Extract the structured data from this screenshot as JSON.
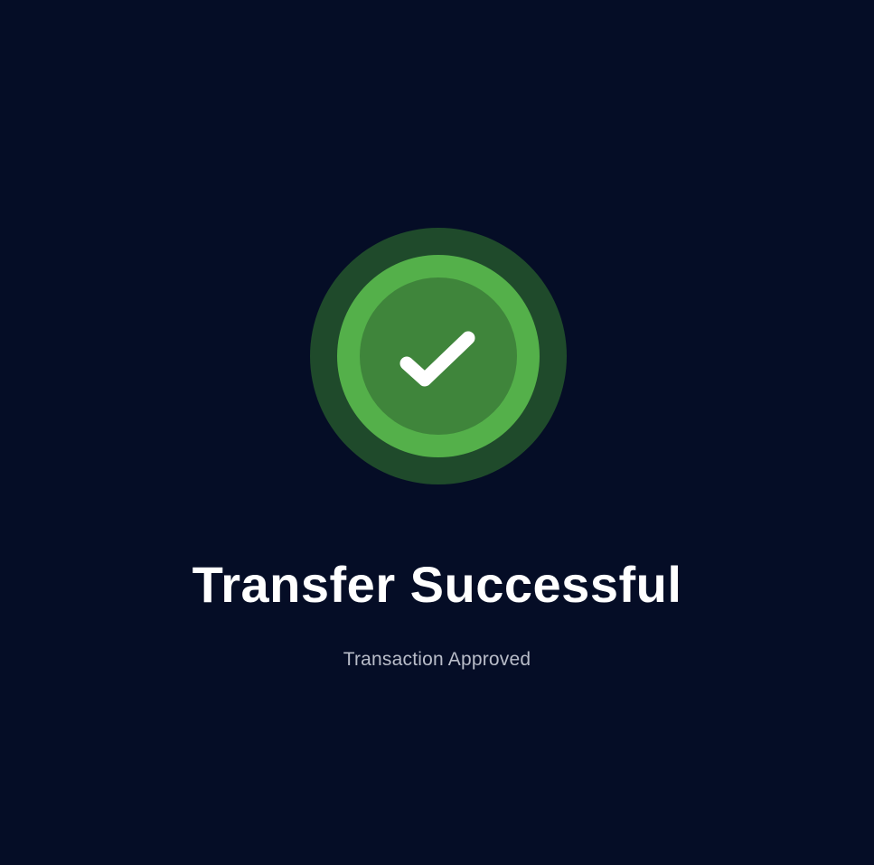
{
  "colors": {
    "background": "#050d26",
    "outer_glow": "#1f4a2b",
    "ring": "#54b04a",
    "core": "#3f853b",
    "checkmark": "#ffffff",
    "title_text": "#ffffff",
    "subtitle_text": "#b9bdc9"
  },
  "status": {
    "icon": "checkmark-icon",
    "title": "Transfer Successful",
    "subtitle": "Transaction Approved"
  }
}
